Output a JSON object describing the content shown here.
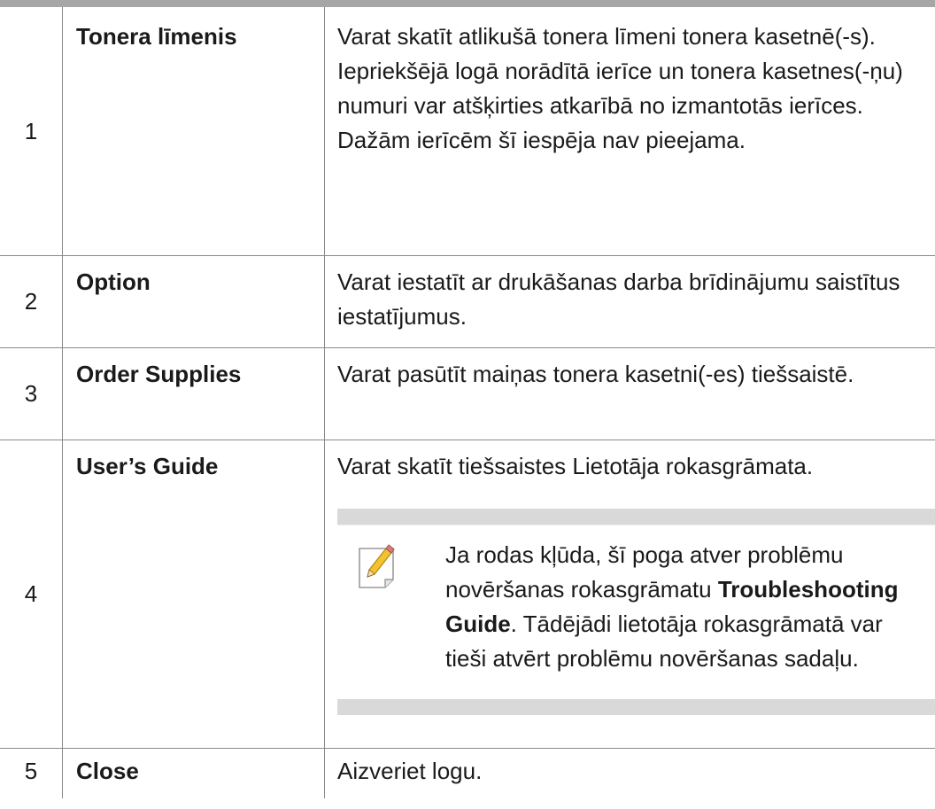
{
  "rows": [
    {
      "num": "1",
      "name": "Tonera līmenis",
      "desc": "Varat skatīt atlikušā tonera līmeni tonera kasetnē(-s). Iepriekšējā logā norādītā ierīce un tonera kasetnes(-ņu) numuri var atšķirties atkarībā no izmantotās ierīces. Dažām ierīcēm šī iespēja nav pieejama."
    },
    {
      "num": "2",
      "name": "Option",
      "desc": "Varat iestatīt ar drukāšanas darba brīdinājumu saistītus iestatījumus."
    },
    {
      "num": "3",
      "name": "Order Supplies",
      "desc": "Varat pasūtīt maiņas tonera kasetni(-es) tiešsaistē."
    },
    {
      "num": "4",
      "name": "User’s Guide",
      "desc": "Varat skatīt tiešsaistes Lietotāja rokasgrāmata.",
      "note": {
        "icon": "note-pencil-icon",
        "text_before": "Ja rodas kļūda, šī poga atver problēmu novēršanas rokasgrāmatu ",
        "bold": "Troubleshooting Guide",
        "text_after": ". Tādējādi lietotāja rokasgrāmatā var tieši atvērt problēmu novēršanas sadaļu."
      }
    },
    {
      "num": "5",
      "name": "Close",
      "desc": "Aizveriet logu."
    }
  ],
  "colors": {
    "top_rule": "#a6a6a6",
    "grid": "#8a8a8a",
    "note_band": "#d9d9d9",
    "pencil": "#f2c230"
  }
}
